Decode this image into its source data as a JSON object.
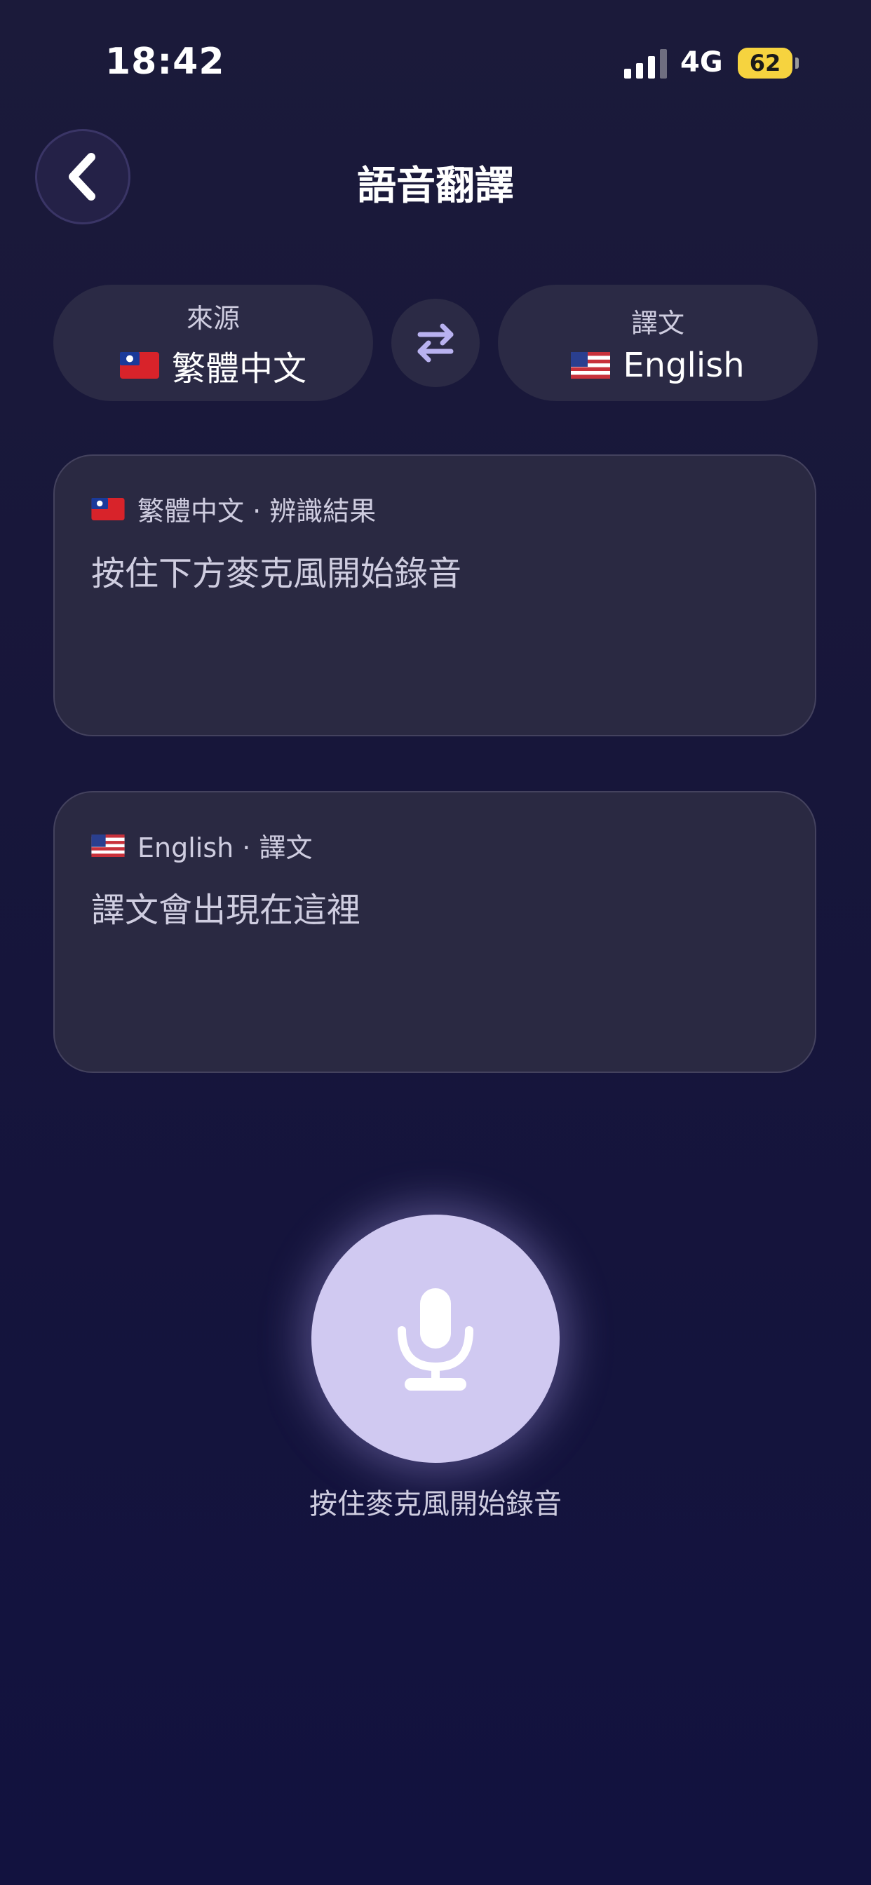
{
  "status_bar": {
    "time": "18:42",
    "network": "4G",
    "battery": "62"
  },
  "header": {
    "title": "語音翻譯",
    "back_icon": "chevron-left-icon"
  },
  "languages": {
    "source": {
      "caption": "來源",
      "flag": "taiwan-flag-icon",
      "name": "繁體中文"
    },
    "swap_icon": "swap-arrows-icon",
    "target": {
      "caption": "譯文",
      "flag": "us-flag-icon",
      "name": "English"
    }
  },
  "source_card": {
    "header": "繁體中文 · 辨識結果",
    "placeholder": "按住下方麥克風開始錄音"
  },
  "target_card": {
    "header": "English · 譯文",
    "placeholder": "譯文會出現在這裡"
  },
  "mic": {
    "icon": "microphone-icon",
    "hint": "按住麥克風開始錄音"
  },
  "colors": {
    "background": "#17163a",
    "pill": "#2b2a45",
    "card": "#2a2942",
    "mic_fill": "#d0c9f1",
    "icon_accent": "#b9b2f0",
    "battery": "#f6d33f"
  }
}
